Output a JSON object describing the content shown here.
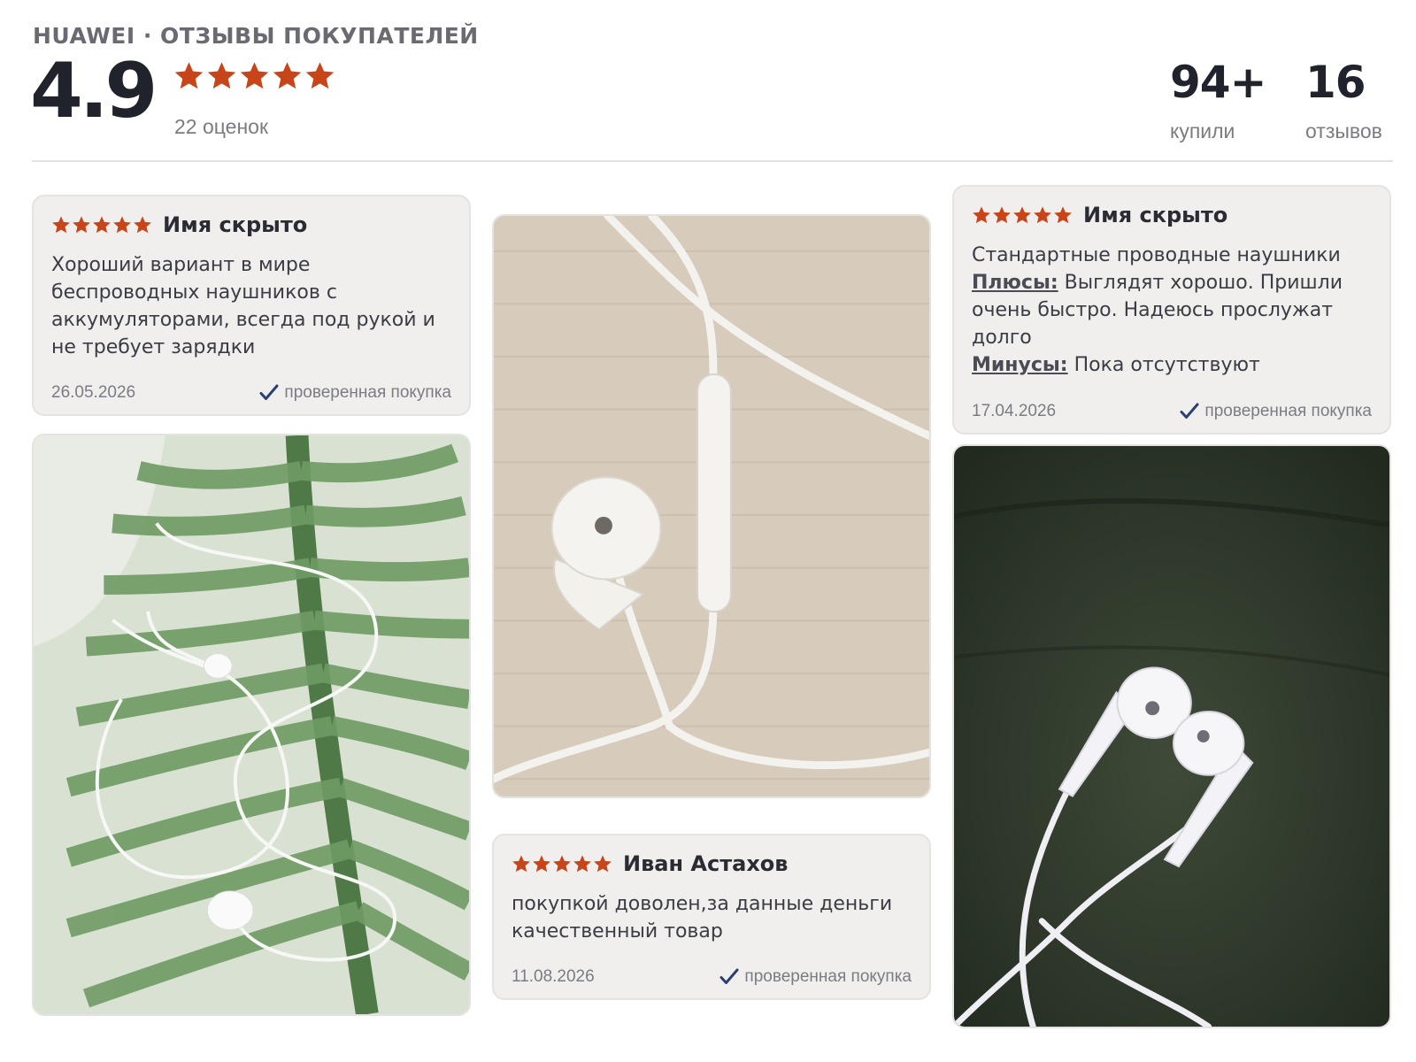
{
  "header": {
    "brand_title": "HUAWEI · ОТЗЫВЫ ПОКУПАТЕЛЕЙ",
    "average_rating": "4.9",
    "ratings_count": "22 оценок",
    "bought_value": "94+",
    "bought_label": "купили",
    "reviews_value": "16",
    "reviews_label": "отзывов",
    "star_rating": 5
  },
  "colors": {
    "star": "#c8451a",
    "check": "#2d3e73",
    "card_bg": "#f0efed"
  },
  "icons": {
    "star": "star-icon",
    "verified": "checkmark-icon"
  },
  "reviews": [
    {
      "author": "Имя скрыто",
      "stars": 5,
      "text": "Хороший вариант в мире беспроводных наушников с аккумуляторами, всегда под рукой и не требует зарядки",
      "date": "26.05.2026",
      "verified": "проверенная покупка"
    },
    {
      "author": "Иван Астахов",
      "stars": 5,
      "text": "покупкой доволен,за данные деньги качественный товар",
      "date": "11.08.2026",
      "verified": "проверенная покупка"
    },
    {
      "author": "Имя скрыто",
      "stars": 5,
      "text": "Стандартные проводные наушники",
      "pros_label": "Плюсы:",
      "pros_text": "Выглядят хорошо. Пришли очень быстро. Надеюсь прослужат долго",
      "cons_label": "Минусы:",
      "cons_text": "Пока отсутствуют",
      "date": "17.04.2026",
      "verified": "проверенная покупка"
    }
  ]
}
